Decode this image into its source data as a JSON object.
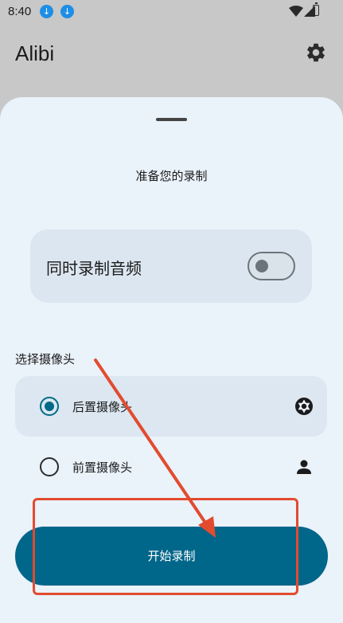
{
  "status_bar": {
    "time": "8:40",
    "download_icon": "arrow-down-icon"
  },
  "app_bar": {
    "title": "Alibi",
    "settings_icon": "gear-icon"
  },
  "sheet": {
    "title": "准备您的录制",
    "audio_option": {
      "label": "同时录制音频",
      "enabled": false
    },
    "camera_section_label": "选择摄像头",
    "cameras": [
      {
        "label": "后置摄像头",
        "selected": true,
        "icon": "camera-aperture-icon"
      },
      {
        "label": "前置摄像头",
        "selected": false,
        "icon": "person-icon"
      }
    ],
    "start_button_label": "开始录制"
  },
  "colors": {
    "accent": "#00668a",
    "sheet_background": "#eaf2fa",
    "annotation": "#e24b2f"
  }
}
